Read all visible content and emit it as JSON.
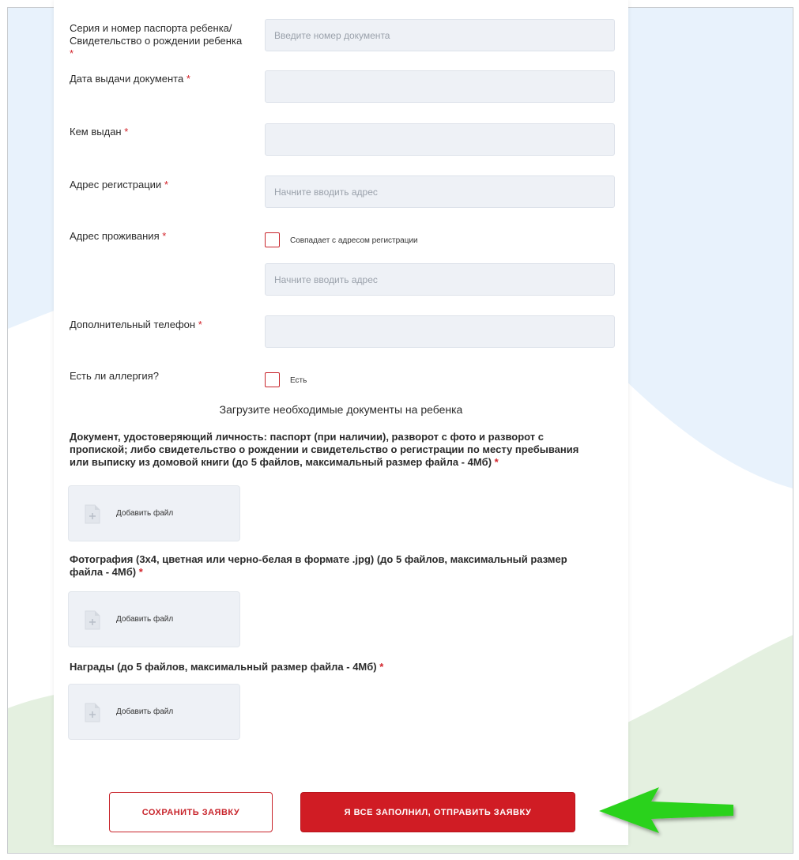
{
  "form": {
    "passport": {
      "label_line1": "Серия и номер паспорта ребенка/",
      "label_line2": "Свидетельство о рождении ребенка",
      "required_mark": "*",
      "placeholder": "Введите номер документа",
      "value": ""
    },
    "issue_date": {
      "label": "Дата выдачи документа",
      "required_mark": "*",
      "value": ""
    },
    "issued_by": {
      "label": "Кем выдан",
      "required_mark": "*",
      "value": ""
    },
    "reg_address": {
      "label": "Адрес регистрации",
      "required_mark": "*",
      "placeholder": "Начните вводить адрес",
      "value": ""
    },
    "live_address": {
      "label": "Адрес проживания",
      "required_mark": "*",
      "checkbox_label": "Совпадает с адресом регистрации",
      "checked": false,
      "placeholder": "Начните вводить адрес",
      "value": ""
    },
    "extra_phone": {
      "label": "Дополнительный телефон",
      "required_mark": "*",
      "value": ""
    },
    "allergy": {
      "label": "Есть ли аллергия?",
      "checkbox_label": "Есть",
      "checked": false
    }
  },
  "uploads": {
    "title": "Загрузите необходимые документы на ребенка",
    "add_file_label": "Добавить файл",
    "items": [
      {
        "line1": "Документ, удостоверяющий личность: паспорт (при наличии), разворот с фото и разворот с",
        "line2": "пропиской; либо свидетельство о рождении и свидетельство о регистрации по месту пребывания",
        "line3": "или выписку из домовой книги (до 5 файлов, максимальный размер файла - 4Мб)",
        "required_mark": "*"
      },
      {
        "line1": "Фотография (3х4, цветная или черно-белая в формате .jpg) (до 5 файлов, максимальный размер",
        "line2": "файла - 4Мб)",
        "required_mark": "*"
      },
      {
        "line1": "Награды (до 5 файлов, максимальный размер файла - 4Мб)",
        "required_mark": "*"
      }
    ]
  },
  "actions": {
    "save_label": "СОХРАНИТЬ ЗАЯВКУ",
    "submit_label": "Я ВСЕ ЗАПОЛНИЛ, ОТПРАВИТЬ ЗАЯВКУ"
  },
  "colors": {
    "accent": "#d01c24",
    "field_bg": "#eef1f6",
    "annotation_arrow": "#2ad21a",
    "bg_blue": "#e8f2fc",
    "bg_green": "#e4f0e0"
  },
  "icons": {
    "file": "file-plus-icon",
    "annotation": "green-arrow-icon"
  }
}
